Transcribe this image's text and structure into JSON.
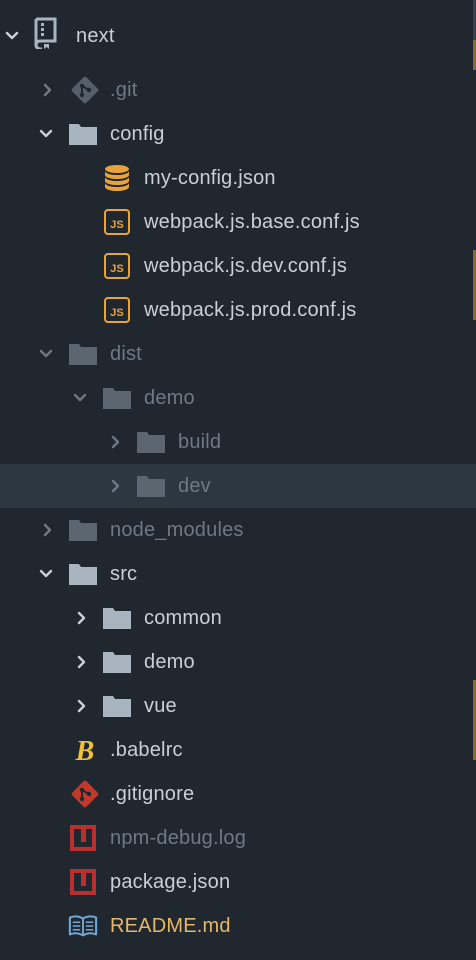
{
  "tree": {
    "root": {
      "label": "next"
    },
    "items": [
      {
        "label": ".git",
        "type": "git-folder",
        "expanded": false,
        "dim": true
      },
      {
        "label": "config",
        "type": "folder",
        "expanded": true,
        "dim": false
      },
      {
        "label": "my-config.json",
        "type": "json-file"
      },
      {
        "label": "webpack.js.base.conf.js",
        "type": "js-file"
      },
      {
        "label": "webpack.js.dev.conf.js",
        "type": "js-file"
      },
      {
        "label": "webpack.js.prod.conf.js",
        "type": "js-file"
      },
      {
        "label": "dist",
        "type": "folder",
        "expanded": true,
        "dim": true
      },
      {
        "label": "demo",
        "type": "folder",
        "expanded": true,
        "dim": true
      },
      {
        "label": "build",
        "type": "folder",
        "expanded": false,
        "dim": true
      },
      {
        "label": "dev",
        "type": "folder",
        "expanded": false,
        "dim": true,
        "selected": true
      },
      {
        "label": "node_modules",
        "type": "folder",
        "expanded": false,
        "dim": true
      },
      {
        "label": "src",
        "type": "folder",
        "expanded": true,
        "dim": false
      },
      {
        "label": "common",
        "type": "folder",
        "expanded": false,
        "dim": false
      },
      {
        "label": "demo",
        "type": "folder",
        "expanded": false,
        "dim": false
      },
      {
        "label": "vue",
        "type": "folder",
        "expanded": false,
        "dim": false
      },
      {
        "label": ".babelrc",
        "type": "babel-file"
      },
      {
        "label": ".gitignore",
        "type": "git-file"
      },
      {
        "label": "npm-debug.log",
        "type": "npm-file",
        "dim": true
      },
      {
        "label": "package.json",
        "type": "npm-file"
      },
      {
        "label": "README.md",
        "type": "readme-file",
        "modified": true
      }
    ]
  },
  "colors": {
    "background": "#21272e",
    "selected_row": "#2d3740",
    "text": "#c8d0d8",
    "text_dim": "#6d7a86",
    "folder": "#a8b4bf",
    "folder_dim": "#5b6670",
    "json_icon": "#e8a33a",
    "js_icon": "#e8a33a",
    "git_icon": "#c0392b",
    "npm_icon": "#b8312f",
    "babel_icon": "#f0c03a",
    "readme_icon": "#6fa8d8",
    "modified_text": "#e3b86a"
  }
}
